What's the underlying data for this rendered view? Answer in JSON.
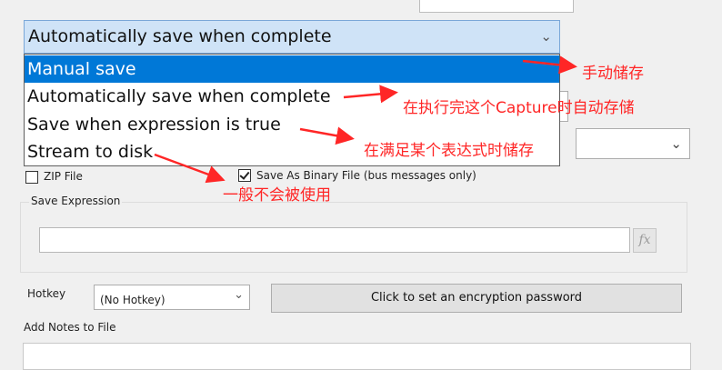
{
  "save_mode": {
    "selected_value": "Automatically save when complete",
    "options": [
      {
        "label": "Manual save",
        "highlighted": true
      },
      {
        "label": "Automatically save when complete",
        "highlighted": false
      },
      {
        "label": "Save when expression is true",
        "highlighted": false
      },
      {
        "label": "Stream to disk",
        "highlighted": false
      }
    ]
  },
  "file_options": {
    "zip_label": "ZIP File",
    "zip_checked": false,
    "binary_label": "Save As Binary File (bus messages only)",
    "binary_checked": true
  },
  "save_expression": {
    "group_label": "Save Expression",
    "value": "",
    "fx_label": "fx"
  },
  "hotkey": {
    "label": "Hotkey",
    "value": "(No Hotkey)"
  },
  "encryption_button_label": "Click to set an encryption password",
  "notes_label": "Add Notes to File",
  "annotations": {
    "manual": "手动储存",
    "auto": "在执行完这个Capture时自动存储",
    "expression": "在满足某个表达式时储存",
    "stream": "一般不会被使用"
  },
  "colors": {
    "annotation": "#ff2626",
    "selection": "#0078d7",
    "combo_focus": "#cfe3f7"
  }
}
